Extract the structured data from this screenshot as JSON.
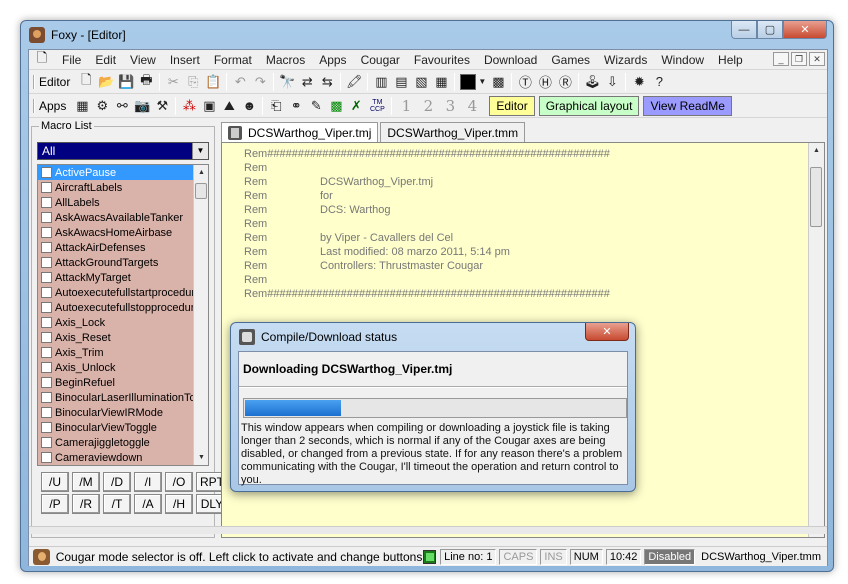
{
  "window": {
    "title": "Foxy - [Editor]"
  },
  "caption": {
    "minimize": "—",
    "restore": "▢",
    "close": "✕"
  },
  "menu": [
    "File",
    "Edit",
    "View",
    "Insert",
    "Format",
    "Macros",
    "Apps",
    "Cougar",
    "Favourites",
    "Download",
    "Games",
    "Wizards",
    "Window",
    "Help"
  ],
  "toolbar1": {
    "label": "Editor"
  },
  "toolbar2": {
    "label": "Apps",
    "numbers": [
      "1",
      "2",
      "3",
      "4"
    ],
    "editor_label": "Editor",
    "graphical_label": "Graphical layout",
    "readme_label": "View ReadMe",
    "ccp_label": "TM CCP"
  },
  "macro_list": {
    "title": "Macro List",
    "filter": "All",
    "items": [
      "ActivePause",
      "AircraftLabels",
      "AllLabels",
      "AskAwacsAvailableTanker",
      "AskAwacsHomeAirbase",
      "AttackAirDefenses",
      "AttackGroundTargets",
      "AttackMyTarget",
      "Autoexecutefullstartprocedure",
      "Autoexecutefullstopprocedure",
      "Axis_Lock",
      "Axis_Reset",
      "Axis_Trim",
      "Axis_Unlock",
      "BeginRefuel",
      "BinocularLaserIlluminationTog",
      "BinocularViewIRMode",
      "BinocularViewToggle",
      "Camerajiggletoggle",
      "Cameraviewdown"
    ],
    "selected_index": 0,
    "commands": [
      "/U",
      "/M",
      "/D",
      "/I",
      "/O",
      "RPT",
      "/P",
      "/R",
      "/T",
      "/A",
      "/H",
      "DLY"
    ]
  },
  "tabs": [
    "DCSWarthog_Viper.tmj",
    "DCSWarthog_Viper.tmm"
  ],
  "editor": {
    "lines": [
      {
        "kw": "Rem",
        "text": "########################################################"
      },
      {
        "kw": "Rem",
        "text": ""
      },
      {
        "kw": "Rem",
        "text": "DCSWarthog_Viper.tmj"
      },
      {
        "kw": "Rem",
        "text": "for"
      },
      {
        "kw": "Rem",
        "text": "DCS: Warthog"
      },
      {
        "kw": "Rem",
        "text": ""
      },
      {
        "kw": "Rem",
        "text": "by Viper - Cavallers del Cel"
      },
      {
        "kw": "Rem",
        "text": "Last modified: 08 marzo 2011, 5:14 pm"
      },
      {
        "kw": "Rem",
        "text": "Controllers: Thrustmaster Cougar"
      },
      {
        "kw": "Rem",
        "text": ""
      },
      {
        "kw": "Rem",
        "text": "########################################################"
      }
    ]
  },
  "dialog": {
    "title": "Compile/Download status",
    "close": "✕",
    "heading": "Downloading DCSWarthog_Viper.tmj",
    "progress": 0.25,
    "message": "This window appears when compiling or downloading a joystick file is taking longer than 2 seconds, which is normal if any of the Cougar axes are being disabled, or changed from a previous state. If for any reason there's a problem communicating with the Cougar, I'll timeout the operation and return control to you."
  },
  "status": {
    "message": "Cougar mode selector is off. Left click to activate and change buttons mode",
    "line": "Line no: 1",
    "caps": "CAPS",
    "ins": "INS",
    "num": "NUM",
    "time": "10:42",
    "state": "Disabled",
    "file": "DCSWarthog_Viper.tmm"
  }
}
